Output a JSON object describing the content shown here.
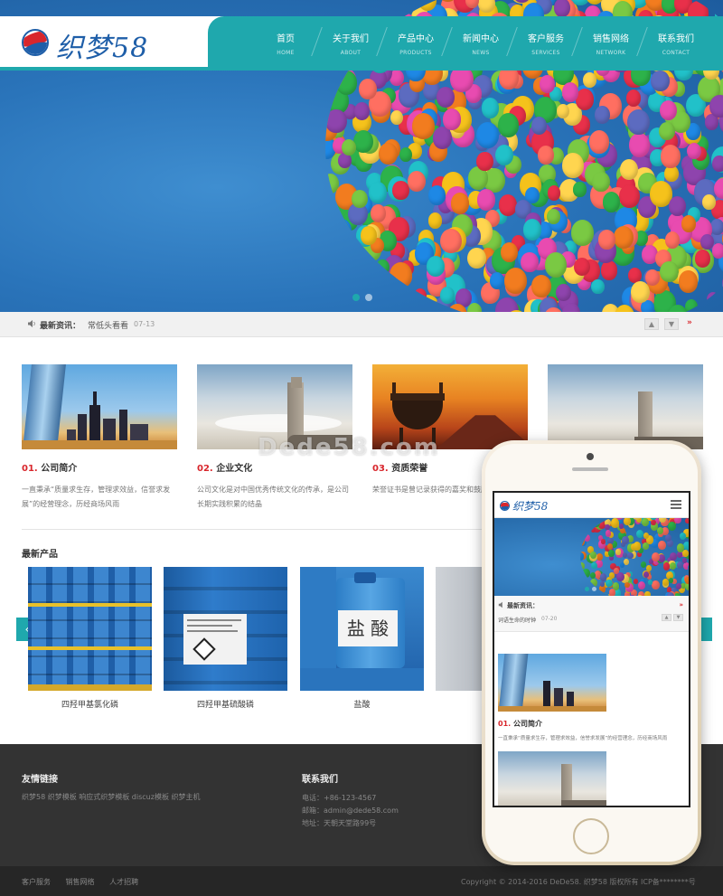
{
  "brand": {
    "logo_text": "织梦58",
    "colors": {
      "accent": "#1fa8ad",
      "brand_blue": "#1e5ea8",
      "highlight_red": "#d8262c"
    }
  },
  "nav": {
    "items": [
      {
        "cn": "首页",
        "en": "HOME"
      },
      {
        "cn": "关于我们",
        "en": "ABOUT"
      },
      {
        "cn": "产品中心",
        "en": "PRODUCTS"
      },
      {
        "cn": "新闻中心",
        "en": "NEWS"
      },
      {
        "cn": "客户服务",
        "en": "SERVICES"
      },
      {
        "cn": "销售网络",
        "en": "NETWORK"
      },
      {
        "cn": "联系我们",
        "en": "CONTACT"
      }
    ]
  },
  "news_strip": {
    "label": "最新资讯：",
    "title": "常低头看看",
    "date": "07-13",
    "prev_icon": "chevron-up-icon",
    "next_icon": "chevron-down-icon",
    "more": "»"
  },
  "features": [
    {
      "num": "01.",
      "title": "公司简介",
      "text": "一直秉承“质量求生存，管理求效益，信誉求发展”的经营理念，历经商场风雨"
    },
    {
      "num": "02.",
      "title": "企业文化",
      "text": "公司文化是对中国优秀传统文化的传承，是公司长期实践积累的结晶"
    },
    {
      "num": "03.",
      "title": "资质荣誉",
      "text": "荣誉证书是曾记录获得的嘉奖和鼓励的证明证件"
    }
  ],
  "products_section": {
    "title": "最新产品",
    "prev_label": "‹",
    "items": [
      {
        "name": "四羟甲基氯化磷"
      },
      {
        "name": "四羟甲基硫酸磷"
      },
      {
        "name": "盐酸",
        "drum_label": "盐 酸"
      },
      {
        "name": ""
      }
    ]
  },
  "watermark": "Dede58.com",
  "footer": {
    "links_title": "友情链接",
    "links": "织梦58 织梦模板 响应式织梦模板 discuz模板 织梦主机",
    "contact_title": "联系我们",
    "phone": "电话：+86-123-4567",
    "email": "邮箱：admin@dede58.com",
    "address": "地址：天朝天堂路99号"
  },
  "bottom_bar": {
    "links": [
      "客户服务",
      "销售网络",
      "人才招聘"
    ],
    "copyright": "Copyright © 2014-2016 DeDe58. 织梦58 版权所有    ICP备********号"
  },
  "phone_mockup": {
    "logo_text": "织梦58",
    "news_label": "最新资讯：",
    "news_more": "»",
    "news_title": "词语生命的时钟",
    "news_date": "07-20",
    "feature_num": "01.",
    "feature_title": "公司简介",
    "feature_text": "一直秉承“质量求生存，管理求效益，信誉求发展”的经营理念，历经商场风雨"
  }
}
